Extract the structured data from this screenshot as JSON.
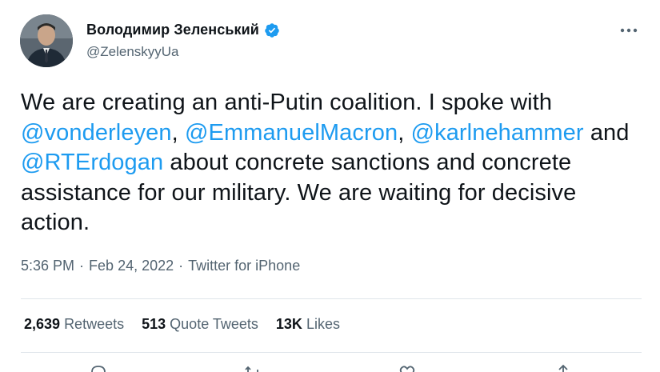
{
  "author": {
    "display_name": "Володимир Зеленський",
    "handle": "@ZelenskyyUa",
    "verified": true
  },
  "tweet": {
    "segments": [
      {
        "type": "text",
        "value": "We are creating an anti-Putin coalition. I spoke with "
      },
      {
        "type": "mention",
        "value": "@vonderleyen"
      },
      {
        "type": "text",
        "value": ", "
      },
      {
        "type": "mention",
        "value": "@EmmanuelMacron"
      },
      {
        "type": "text",
        "value": ", "
      },
      {
        "type": "mention",
        "value": "@karlnehammer"
      },
      {
        "type": "text",
        "value": " and "
      },
      {
        "type": "mention",
        "value": "@RTErdogan"
      },
      {
        "type": "text",
        "value": " about concrete sanctions and concrete assistance for our military. We are waiting for decisive action."
      }
    ]
  },
  "meta": {
    "time": "5:36 PM",
    "separator": "·",
    "date": "Feb 24, 2022",
    "source": "Twitter for iPhone"
  },
  "stats": {
    "retweets_count": "2,639",
    "retweets_label": "Retweets",
    "quotes_count": "513",
    "quotes_label": "Quote Tweets",
    "likes_count": "13K",
    "likes_label": "Likes"
  },
  "icons": {
    "more": "more-horizontal-icon",
    "verified": "verified-badge-icon",
    "actions": [
      "reply-icon",
      "retweet-icon",
      "like-icon",
      "share-icon"
    ]
  },
  "colors": {
    "accent": "#1d9bf0",
    "text": "#0f1419",
    "secondary": "#536471",
    "divider": "#dfe5ea"
  }
}
